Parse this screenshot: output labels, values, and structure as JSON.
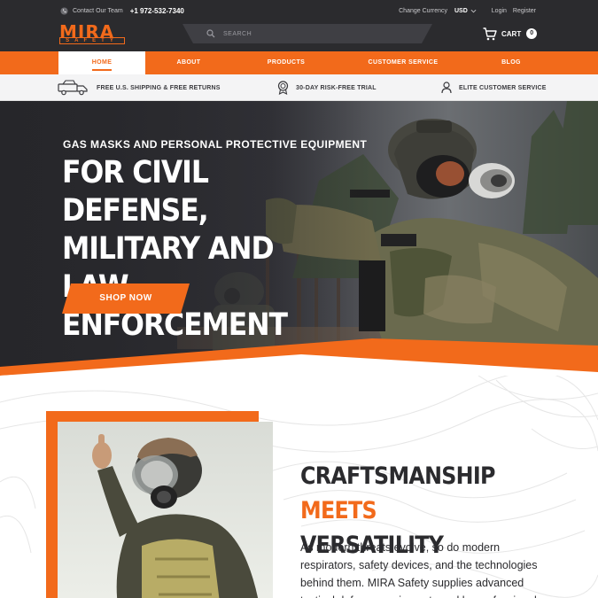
{
  "topbar": {
    "contact_label": "Contact Our Team",
    "phone": "+1 972-532-7340",
    "currency_label": "Change Currency",
    "currency_value": "USD",
    "login": "Login",
    "register": "Register"
  },
  "logo": {
    "name": "MIRA",
    "sub": "SAFETY"
  },
  "search": {
    "placeholder": "SEARCH"
  },
  "cart": {
    "label": "CART",
    "count": "0"
  },
  "nav": {
    "items": [
      {
        "label": "HOME",
        "active": true
      },
      {
        "label": "ABOUT",
        "active": false
      },
      {
        "label": "PRODUCTS",
        "active": false
      },
      {
        "label": "CUSTOMER SERVICE",
        "active": false
      },
      {
        "label": "BLOG",
        "active": false
      }
    ]
  },
  "benefits": [
    {
      "label": "FREE U.S. SHIPPING & FREE RETURNS",
      "icon": "truck-icon"
    },
    {
      "label": "30-DAY RISK-FREE TRIAL",
      "icon": "badge-icon"
    },
    {
      "label": "ELITE CUSTOMER SERVICE",
      "icon": "person-icon"
    }
  ],
  "hero": {
    "kicker": "GAS MASKS AND PERSONAL PROTECTIVE EQUIPMENT",
    "title": "FOR CIVIL DEFENSE, MILITARY AND LAW ENFORCEMENT",
    "cta": "SHOP NOW"
  },
  "section": {
    "title_part1": "CRAFTSMANSHIP",
    "title_accent": "MEETS",
    "title_part2": "VERSATILITY",
    "body": "As modern threats evolve, so do modern respirators, safety devices, and the technologies behind them. MIRA Safety supplies advanced tactical defense equipment used by professionals worldwide – now"
  },
  "colors": {
    "accent": "#f26a1b",
    "dark": "#2b2b2e",
    "light_bg": "#f4f4f5"
  }
}
